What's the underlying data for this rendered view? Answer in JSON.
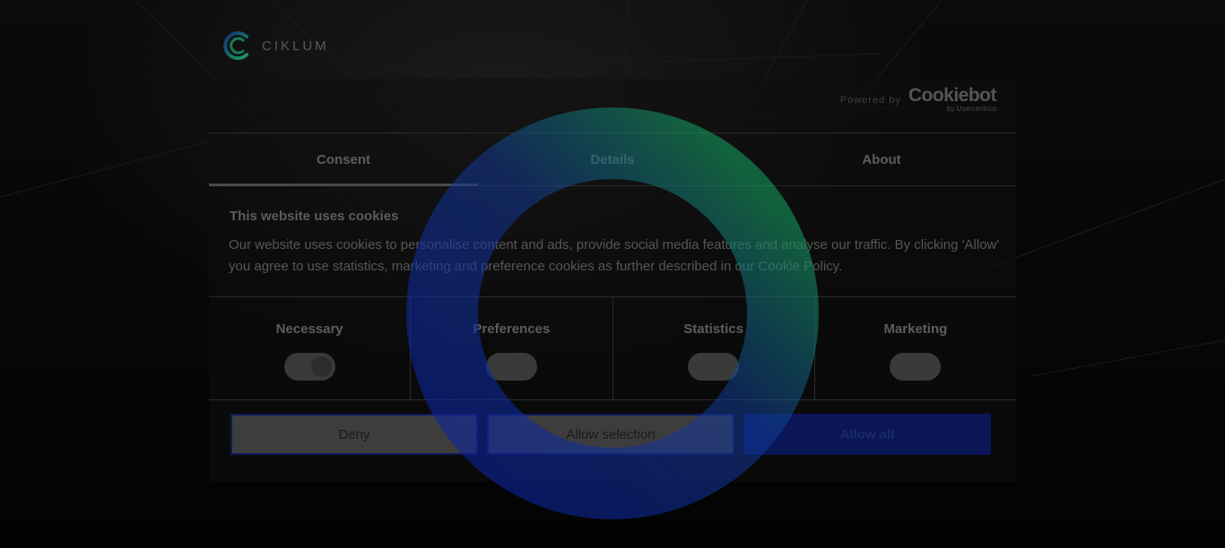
{
  "brand": {
    "name": "CIKLUM"
  },
  "powered": {
    "prefix": "Powered by",
    "name": "Cookiebot",
    "byline": "by Usercentrics"
  },
  "tabs": [
    {
      "label": "Consent",
      "active": true
    },
    {
      "label": "Details",
      "active": false
    },
    {
      "label": "About",
      "active": false
    }
  ],
  "consent": {
    "heading": "This website uses cookies",
    "body": "Our website uses cookies to personalise content and ads, provide social media features and analyse our traffic. By clicking 'Allow' you agree to use statistics, marketing and preference cookies as further described in our Cookie Policy."
  },
  "toggles": [
    {
      "label": "Necessary",
      "checked": true
    },
    {
      "label": "Preferences",
      "checked": false
    },
    {
      "label": "Statistics",
      "checked": false
    },
    {
      "label": "Marketing",
      "checked": false
    }
  ],
  "buttons": {
    "deny": "Deny",
    "allow_selection": "Allow selection",
    "allow_all": "Allow all"
  },
  "colors": {
    "accent": "#0a1658",
    "spinner_blue": "#1230a8",
    "spinner_green": "#1aa060"
  },
  "icons": {
    "logo": "ciklum-logo-icon",
    "spinner": "loading-spinner-icon"
  }
}
